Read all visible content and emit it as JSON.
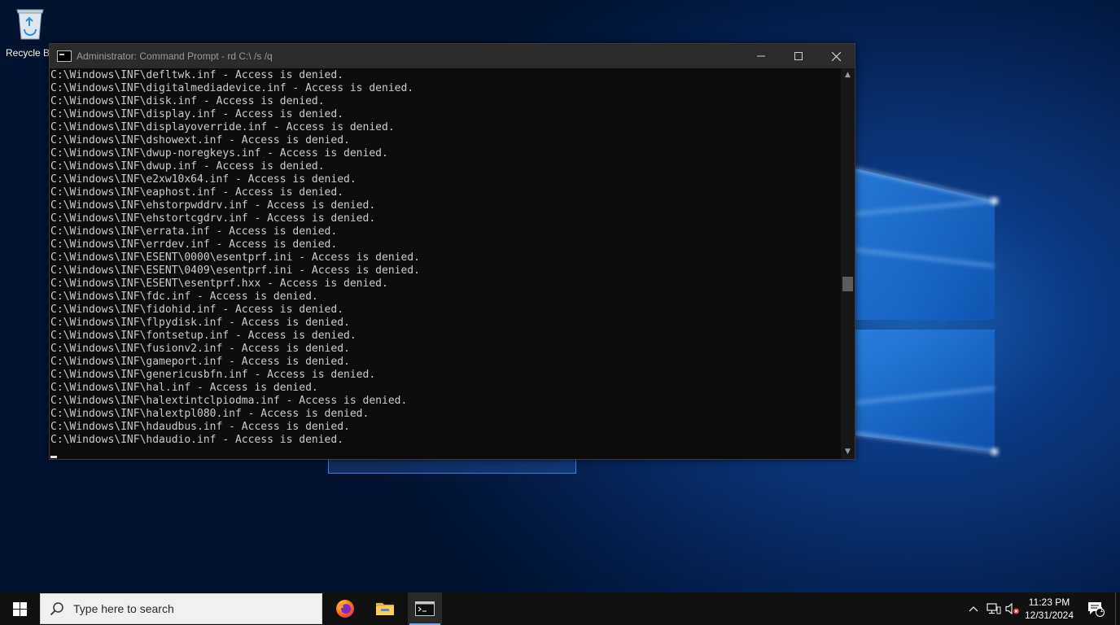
{
  "desktop": {
    "recycle_bin_label": "Recycle Bin"
  },
  "console": {
    "title": "Administrator: Command Prompt - rd  C:\\ /s /q",
    "lines": [
      "C:\\Windows\\INF\\defltwk.inf - Access is denied.",
      "C:\\Windows\\INF\\digitalmediadevice.inf - Access is denied.",
      "C:\\Windows\\INF\\disk.inf - Access is denied.",
      "C:\\Windows\\INF\\display.inf - Access is denied.",
      "C:\\Windows\\INF\\displayoverride.inf - Access is denied.",
      "C:\\Windows\\INF\\dshowext.inf - Access is denied.",
      "C:\\Windows\\INF\\dwup-noregkeys.inf - Access is denied.",
      "C:\\Windows\\INF\\dwup.inf - Access is denied.",
      "C:\\Windows\\INF\\e2xw10x64.inf - Access is denied.",
      "C:\\Windows\\INF\\eaphost.inf - Access is denied.",
      "C:\\Windows\\INF\\ehstorpwddrv.inf - Access is denied.",
      "C:\\Windows\\INF\\ehstortcgdrv.inf - Access is denied.",
      "C:\\Windows\\INF\\errata.inf - Access is denied.",
      "C:\\Windows\\INF\\errdev.inf - Access is denied.",
      "C:\\Windows\\INF\\ESENT\\0000\\esentprf.ini - Access is denied.",
      "C:\\Windows\\INF\\ESENT\\0409\\esentprf.ini - Access is denied.",
      "C:\\Windows\\INF\\ESENT\\esentprf.hxx - Access is denied.",
      "C:\\Windows\\INF\\fdc.inf - Access is denied.",
      "C:\\Windows\\INF\\fidohid.inf - Access is denied.",
      "C:\\Windows\\INF\\flpydisk.inf - Access is denied.",
      "C:\\Windows\\INF\\fontsetup.inf - Access is denied.",
      "C:\\Windows\\INF\\fusionv2.inf - Access is denied.",
      "C:\\Windows\\INF\\gameport.inf - Access is denied.",
      "C:\\Windows\\INF\\genericusbfn.inf - Access is denied.",
      "C:\\Windows\\INF\\hal.inf - Access is denied.",
      "C:\\Windows\\INF\\halextintclpiodma.inf - Access is denied.",
      "C:\\Windows\\INF\\halextpl080.inf - Access is denied.",
      "C:\\Windows\\INF\\hdaudbus.inf - Access is denied.",
      "C:\\Windows\\INF\\hdaudio.inf - Access is denied."
    ]
  },
  "taskbar": {
    "search_placeholder": "Type here to search",
    "apps": [
      "firefox-icon",
      "file-explorer-icon",
      "command-prompt-icon"
    ],
    "clock_time": "11:23 PM",
    "clock_date": "12/31/2024",
    "notification_count": "1"
  },
  "colors": {
    "console_bg": "#0c0c0c",
    "console_text": "#cccccc",
    "titlebar_bg": "#2b2b2b",
    "taskbar_bg": "#101010",
    "accent": "#7aa7e6"
  }
}
